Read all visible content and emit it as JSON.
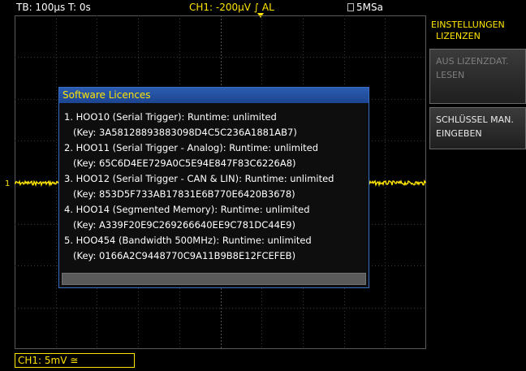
{
  "status_bar": {
    "timebase": "TB: 100µs  T: 0s",
    "trigger": "CH1: -200µV ∫ AL",
    "sample_rate": "5MSa"
  },
  "channel": {
    "marker": "1",
    "label": "CH1: 5mV ≅",
    "color": "#ffe400"
  },
  "dialog": {
    "title": "Software Licences",
    "licences": [
      {
        "line1": "1. HOO10 (Serial Trigger): Runtime: unlimited",
        "line2": "(Key: 3A58128893883098D4C5C236A1881AB7)"
      },
      {
        "line1": "2. HOO11 (Serial Trigger - Analog): Runtime: unlimited",
        "line2": "(Key: 65C6D4EE729A0C5E94E847F83C6226A8)"
      },
      {
        "line1": "3. HOO12 (Serial Trigger - CAN & LIN): Runtime: unlimited",
        "line2": "(Key: 853D5F733AB17831E6B770E6420B3678)"
      },
      {
        "line1": "4. HOO14 (Segmented Memory): Runtime: unlimited",
        "line2": "(Key: A339F20E9C269266640EE9C781DC44E9)"
      },
      {
        "line1": "5. HOO454 (Bandwidth 500MHz): Runtime: unlimited",
        "line2": "(Key: 0166A2C9448770C9A11B9B8E12FCEFEB)"
      }
    ]
  },
  "menu": {
    "title_line1": "EINSTELLUNGEN",
    "title_line2": "LIZENZEN",
    "softkeys": [
      {
        "line1": "AUS LIZENZDAT.",
        "line2": "LESEN",
        "enabled": false
      },
      {
        "line1": "SCHLÜSSEL MAN.",
        "line2": "EINGEBEN",
        "enabled": true
      }
    ]
  },
  "icons": {
    "sample_rate": "memory-card-icon",
    "trigger_position": "trigger-marker-icon",
    "channel_marker": "channel-1-marker-icon"
  }
}
